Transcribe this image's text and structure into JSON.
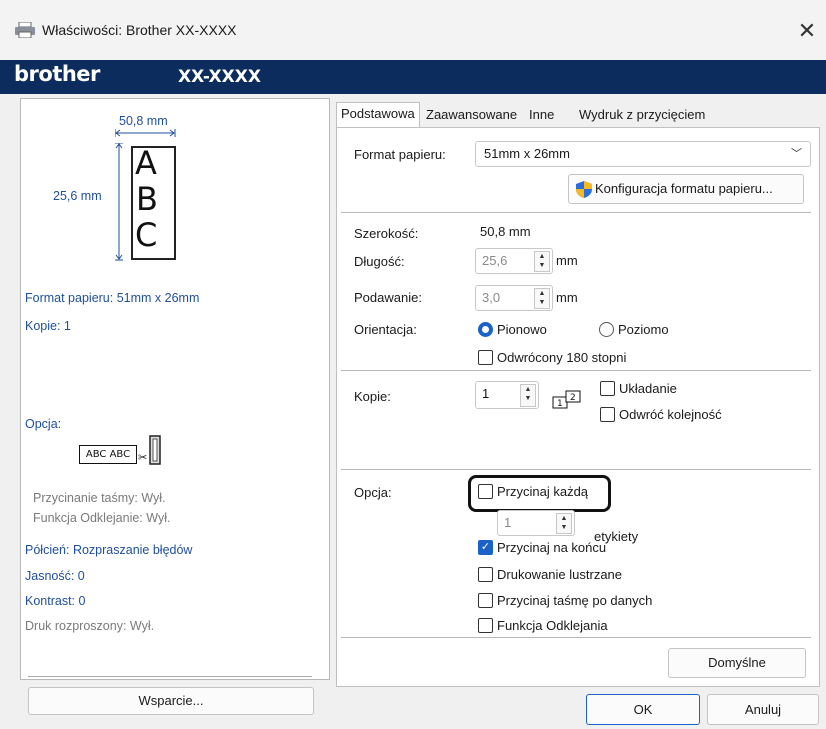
{
  "window": {
    "title": "Właściwości: Brother XX-XXXX",
    "close_glyph": "✕"
  },
  "brand": {
    "logo": "brother",
    "model": "XX-XXXX"
  },
  "preview": {
    "width_dim": "50,8 mm",
    "height_dim": "25,6 mm",
    "sample_letters": [
      "A",
      "B",
      "C"
    ],
    "paper_format": "Format papieru: 51mm x 26mm",
    "copies": "Kopie: 1",
    "option_title": "Opcja:",
    "tape_sample": "ABC ABC",
    "cut_tape": "Przycinanie taśmy: Wył.",
    "peel_function": "Funkcja Odklejanie: Wył.",
    "halftone": "Półcień: Rozpraszanie błędów",
    "brightness": "Jasność:  0",
    "contrast": "Kontrast:  0",
    "dither": "Druk rozproszony: Wył.",
    "support_button": "Wsparcie..."
  },
  "tabs": [
    "Podstawowa",
    "Zaawansowane",
    "Inne",
    "Wydruk z przycięciem"
  ],
  "basic": {
    "paper_format_label": "Format papieru:",
    "paper_format_value": "51mm x 26mm",
    "paper_config_button": "Konfiguracja formatu papieru...",
    "width_label": "Szerokość:",
    "width_value": "50,8 mm",
    "length_label": "Długość:",
    "length_value": "25,6",
    "feed_label": "Podawanie:",
    "feed_value": "3,0",
    "unit_mm": "mm",
    "orientation_label": "Orientacja:",
    "portrait": "Pionowo",
    "landscape": "Poziomo",
    "rotate180": "Odwrócony 180 stopni",
    "copies_label": "Kopie:",
    "copies_value": "1",
    "collate": "Układanie",
    "reverse_order": "Odwróć kolejność",
    "option_label": "Opcja:",
    "cut_each": "Przycinaj każdą",
    "cut_each_count": "1",
    "labels_unit": "etykiety",
    "cut_at_end": "Przycinaj na końcu",
    "mirror_print": "Drukowanie lustrzane",
    "cut_tape_after_data": "Przycinaj taśmę po danych",
    "peel_function": "Funkcja Odklejania",
    "defaults_button": "Domyślne"
  },
  "footer": {
    "ok": "OK",
    "cancel": "Anuluj"
  },
  "colors": {
    "brand_bar": "#0d2c5e",
    "accent": "#1a62c8",
    "info_blue": "#1f4f9c"
  }
}
